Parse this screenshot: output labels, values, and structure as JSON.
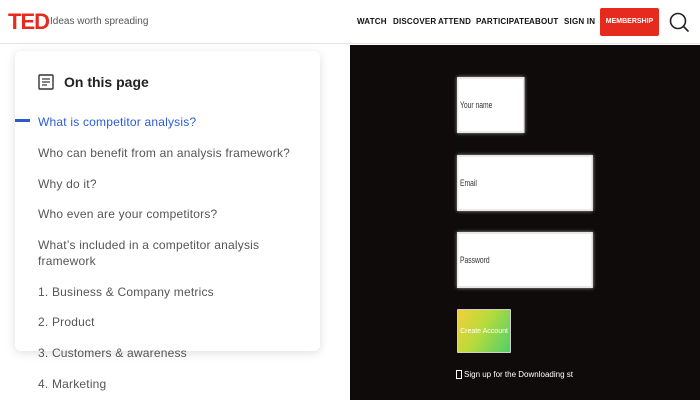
{
  "header": {
    "logo": "TED",
    "tagline": "Ideas worth spreading",
    "nav": [
      "WATCH",
      "DISCOVER",
      "ATTEND",
      "PARTICIPATE",
      "ABOUT",
      "SIGN IN"
    ],
    "membership_label": "MEMBERSHIP",
    "search_icon": "search-icon"
  },
  "toc": {
    "title": "On this page",
    "icon": "document-icon",
    "items": [
      "What is competitor analysis?",
      "Who can benefit from an analysis framework?",
      "Why do it?",
      "Who even are your competitors?",
      "What’s included in a competitor analysis framework",
      "1. Business & Company metrics",
      "2. Product",
      "3. Customers & awareness",
      "4. Marketing"
    ],
    "active_item": "What is competitor analysis?"
  },
  "signup_form": {
    "name_placeholder": "Your name",
    "email_placeholder": "Email",
    "password_placeholder": "Password",
    "submit_label": "Create Account",
    "newsletter_label": "Sign up for the Downloading st"
  },
  "colors": {
    "brand_red": "#e62b1e",
    "active_link": "#2a5bd7",
    "panel_dark": "#100b0b"
  }
}
